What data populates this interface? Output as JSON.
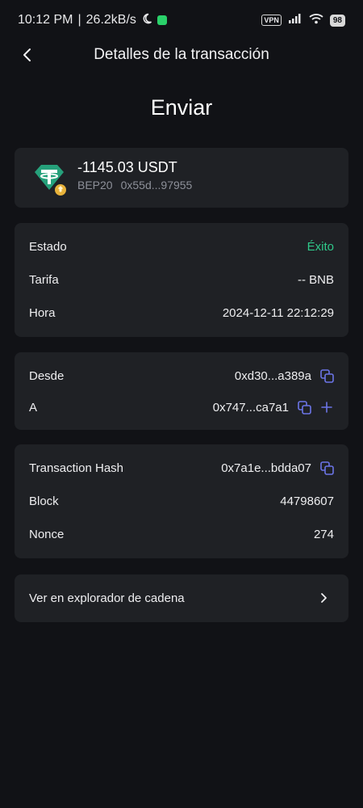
{
  "status_bar": {
    "time": "10:12 PM",
    "separator": "|",
    "speed": "26.2kB/s",
    "vpn_label": "VPN",
    "battery": "98"
  },
  "header": {
    "title": "Detalles de la transacción"
  },
  "heading": "Enviar",
  "token": {
    "amount": "-1145.03 USDT",
    "network": "BEP20",
    "address": "0x55d...97955",
    "brand_color": "#26a17b"
  },
  "details": {
    "status_label": "Estado",
    "status_value": "Éxito",
    "fee_label": "Tarifa",
    "fee_value": "-- BNB",
    "time_label": "Hora",
    "time_value": "2024-12-11 22:12:29"
  },
  "addresses": {
    "from_label": "Desde",
    "from_value": "0xd30...a389a",
    "to_label": "A",
    "to_value": "0x747...ca7a1"
  },
  "chain": {
    "hash_label": "Transaction Hash",
    "hash_value": "0x7a1e...bdda07",
    "block_label": "Block",
    "block_value": "44798607",
    "nonce_label": "Nonce",
    "nonce_value": "274"
  },
  "explorer": {
    "label": "Ver en explorador de cadena"
  },
  "colors": {
    "background": "#111216",
    "card": "#1f2125",
    "success": "#2fc98a",
    "accent_icon": "#6b74e6"
  }
}
